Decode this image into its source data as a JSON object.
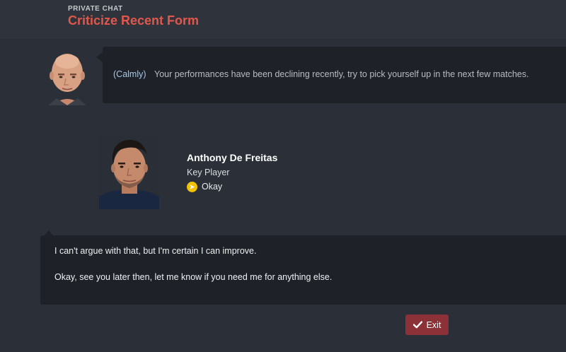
{
  "header": {
    "kicker": "PRIVATE CHAT",
    "title": "Criticize Recent Form"
  },
  "manager_message": {
    "tone": "(Calmly)",
    "text": "Your performances have been declining recently, try to pick yourself up in the next few matches."
  },
  "player": {
    "name": "Anthony De Freitas",
    "role": "Key Player",
    "reaction": "Okay",
    "reaction_color": "#f2c200"
  },
  "reply": {
    "line1": "I can't argue with that, but I'm certain I can improve.",
    "line2": "Okay, see you later then, let me know if you need me for anything else."
  },
  "actions": {
    "exit_label": "Exit",
    "exit_icon": "checkmark-icon"
  },
  "colors": {
    "title_accent": "#e2574c",
    "exit_button": "#8b3137",
    "bubble_bg": "#1e2228",
    "page_bg": "#2b3038"
  }
}
